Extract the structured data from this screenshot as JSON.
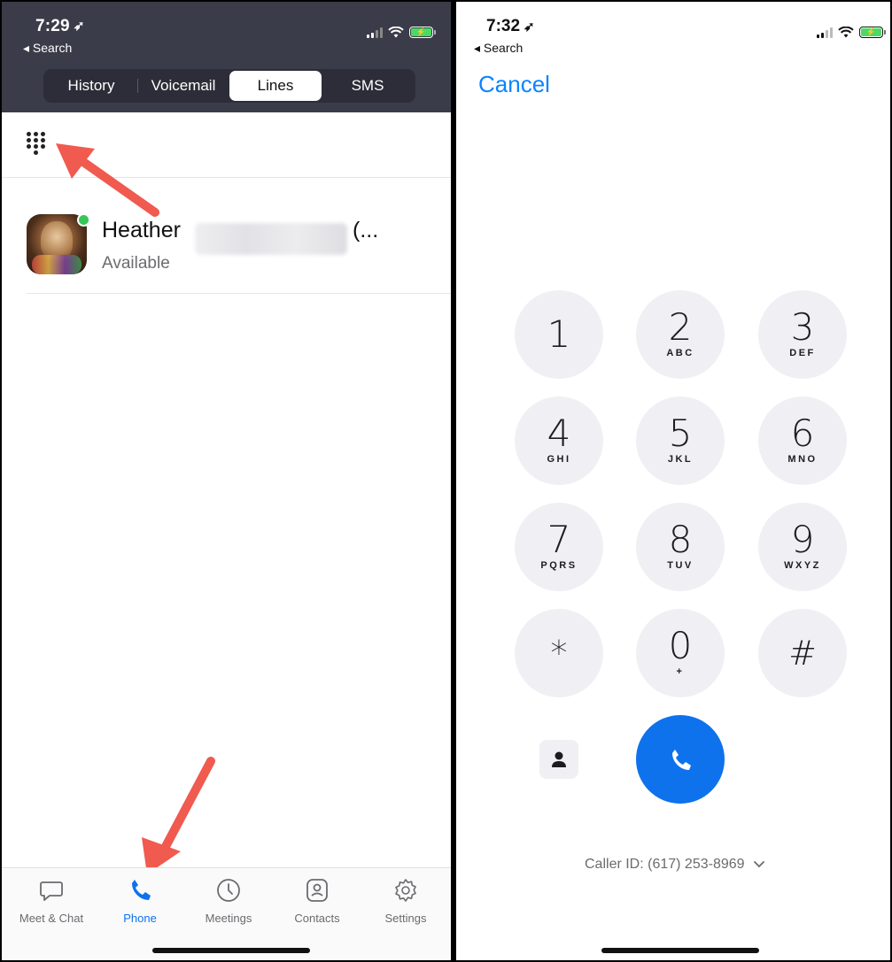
{
  "left": {
    "status": {
      "time": "7:29",
      "back_label": "◂ Search"
    },
    "tabs": [
      {
        "label": "History"
      },
      {
        "label": "Voicemail"
      },
      {
        "label": "Lines"
      },
      {
        "label": "SMS"
      }
    ],
    "active_tab": "Lines",
    "contact": {
      "name_start": "Heather",
      "name_end": "(...",
      "status": "Available",
      "presence_color": "#34c759"
    },
    "tabbar": [
      {
        "label": "Meet & Chat",
        "icon": "chat-bubble-icon"
      },
      {
        "label": "Phone",
        "icon": "phone-icon"
      },
      {
        "label": "Meetings",
        "icon": "clock-icon"
      },
      {
        "label": "Contacts",
        "icon": "contact-card-icon"
      },
      {
        "label": "Settings",
        "icon": "gear-icon"
      }
    ],
    "active_tabbar": "Phone",
    "annotations": {
      "arrow_color": "#f05a4f"
    }
  },
  "right": {
    "status": {
      "time": "7:32",
      "back_label": "◂ Search"
    },
    "cancel_label": "Cancel",
    "keys": [
      {
        "digit": "1",
        "letters": ""
      },
      {
        "digit": "2",
        "letters": "ABC"
      },
      {
        "digit": "3",
        "letters": "DEF"
      },
      {
        "digit": "4",
        "letters": "GHI"
      },
      {
        "digit": "5",
        "letters": "JKL"
      },
      {
        "digit": "6",
        "letters": "MNO"
      },
      {
        "digit": "7",
        "letters": "PQRS"
      },
      {
        "digit": "8",
        "letters": "TUV"
      },
      {
        "digit": "9",
        "letters": "WXYZ"
      },
      {
        "digit": "*",
        "letters": ""
      },
      {
        "digit": "0",
        "letters": "+"
      },
      {
        "digit": "#",
        "letters": ""
      }
    ],
    "caller_id": "Caller ID: (617) 253-8969"
  },
  "colors": {
    "accent": "#0e72ed",
    "header_bg": "#3b3c49",
    "key_bg": "#f0f0f4",
    "cancel": "#0a84ff"
  }
}
